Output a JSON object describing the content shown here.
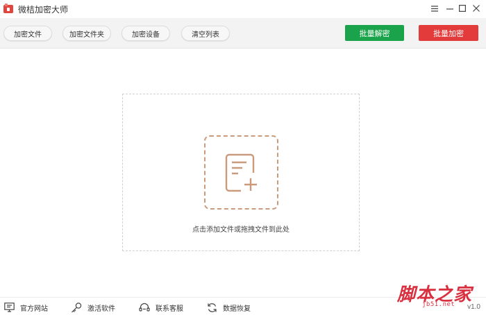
{
  "app": {
    "title": "微桔加密大师",
    "version": "v1.0"
  },
  "toolbar": {
    "encrypt_file": "加密文件",
    "encrypt_folder": "加密文件夹",
    "encrypt_device": "加密设备",
    "clear_list": "清空列表",
    "batch_decrypt": "批量解密",
    "batch_encrypt": "批量加密"
  },
  "colors": {
    "decrypt_green": "#1aa34a",
    "encrypt_red": "#e33b3b",
    "accent_brown": "#c99a7c"
  },
  "drop_zone": {
    "hint": "点击添加文件或拖拽文件到此处",
    "icon": "add-file-icon"
  },
  "footer": {
    "official_site": "官方网站",
    "activate": "激活软件",
    "support": "联系客服",
    "recovery": "数据恢复"
  },
  "watermark": {
    "main": "脚本之家",
    "url": "jb51.net"
  }
}
